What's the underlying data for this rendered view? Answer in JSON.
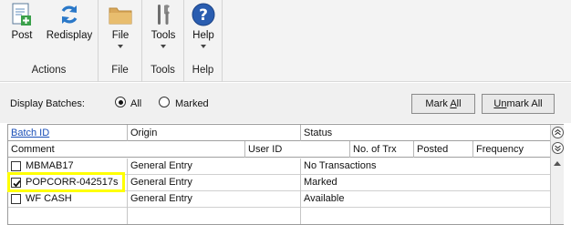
{
  "ribbon": {
    "actions": {
      "title": "Actions",
      "post_label": "Post",
      "redisplay_label": "Redisplay"
    },
    "file": {
      "title": "File",
      "button_label": "File"
    },
    "tools": {
      "title": "Tools",
      "button_label": "Tools"
    },
    "help": {
      "title": "Help",
      "button_label": "Help"
    }
  },
  "options": {
    "display_label": "Display Batches:",
    "radio_all": "All",
    "radio_marked": "Marked",
    "selected": "All",
    "mark_all_pre": "Mark ",
    "mark_all_u": "A",
    "mark_all_post": "ll",
    "unmark_all_pre": "U",
    "unmark_all_u": "n",
    "unmark_all_post": "mark All"
  },
  "grid": {
    "header_row1": {
      "batch_id": "Batch ID",
      "origin": "Origin",
      "status": "Status"
    },
    "header_row2": {
      "comment": "Comment",
      "user_id": "User ID",
      "no_of_trx": "No. of Trx",
      "posted": "Posted",
      "frequency": "Frequency"
    },
    "rows": [
      {
        "batch": "MBMAB17",
        "checked": false,
        "origin": "General Entry",
        "status": "No Transactions"
      },
      {
        "batch": "POPCORR-042517s",
        "checked": true,
        "origin": "General Entry",
        "status": "Marked"
      },
      {
        "batch": "WF CASH",
        "checked": false,
        "origin": "General Entry",
        "status": "Available"
      }
    ]
  },
  "colors": {
    "highlight": "#ffff00",
    "link": "#1a4fb8",
    "help_blue": "#2a5db0"
  }
}
